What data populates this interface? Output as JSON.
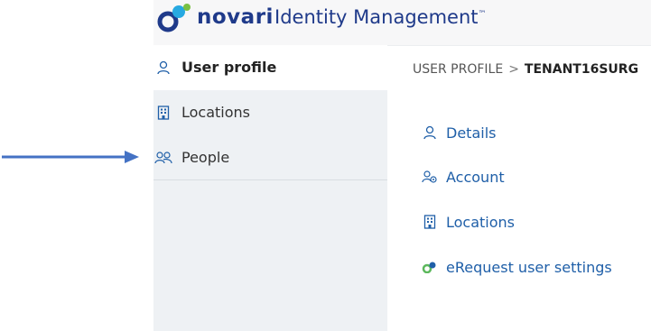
{
  "header": {
    "brand": "novari",
    "app_title": "Identity Management",
    "trademark": "™"
  },
  "sidebar": {
    "items": [
      {
        "label": "User profile",
        "icon": "person-icon",
        "active": true
      },
      {
        "label": "Locations",
        "icon": "building-icon",
        "active": false
      },
      {
        "label": "People",
        "icon": "people-icon",
        "active": false
      }
    ]
  },
  "breadcrumb": {
    "root": "USER PROFILE",
    "separator": ">",
    "current": "TENANT16SURG"
  },
  "menu": {
    "items": [
      {
        "label": "Details",
        "icon": "person-icon"
      },
      {
        "label": "Account",
        "icon": "account-settings-icon"
      },
      {
        "label": "Locations",
        "icon": "building-icon"
      },
      {
        "label": "eRequest user settings",
        "icon": "erequest-icon"
      }
    ]
  },
  "colors": {
    "brand_blue": "#1f3a8a",
    "link_blue": "#1f5fa8",
    "sidebar_bg": "#eef1f4",
    "arrow": "#4472c4",
    "green": "#5cb85c"
  }
}
